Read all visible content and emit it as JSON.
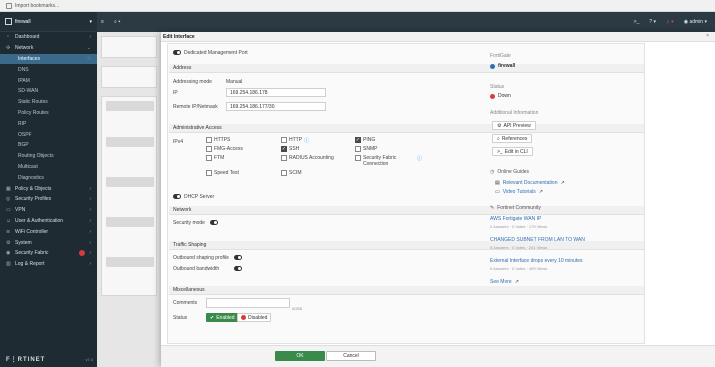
{
  "bookmarks": {
    "label": "Import bookmarks..."
  },
  "sidebar": {
    "device": "firewall",
    "items": [
      {
        "label": "Dashboard",
        "icon": "dashboard-icon",
        "top": true,
        "arrow": "›"
      },
      {
        "label": "Network",
        "icon": "network-icon",
        "top": true,
        "arrow": "⌄"
      },
      {
        "label": "Interfaces",
        "sub": true,
        "active": true,
        "arrow": "☆"
      },
      {
        "label": "DNS",
        "sub": true
      },
      {
        "label": "IPAM",
        "sub": true
      },
      {
        "label": "SD-WAN",
        "sub": true
      },
      {
        "label": "Static Routes",
        "sub": true
      },
      {
        "label": "Policy Routes",
        "sub": true
      },
      {
        "label": "RIP",
        "sub": true
      },
      {
        "label": "OSPF",
        "sub": true
      },
      {
        "label": "BGP",
        "sub": true
      },
      {
        "label": "Routing Objects",
        "sub": true
      },
      {
        "label": "Multicast",
        "sub": true
      },
      {
        "label": "Diagnostics",
        "sub": true
      },
      {
        "label": "Policy & Objects",
        "icon": "policy-icon",
        "top": true,
        "arrow": "›"
      },
      {
        "label": "Security Profiles",
        "icon": "security-profiles-icon",
        "top": true,
        "arrow": "›"
      },
      {
        "label": "VPN",
        "icon": "vpn-icon",
        "top": true,
        "arrow": "›"
      },
      {
        "label": "User & Authentication",
        "icon": "user-icon",
        "top": true,
        "arrow": "›"
      },
      {
        "label": "WiFi Controller",
        "icon": "wifi-icon",
        "top": true,
        "arrow": "›"
      },
      {
        "label": "System",
        "icon": "system-icon",
        "top": true,
        "arrow": "›"
      },
      {
        "label": "Security Fabric",
        "icon": "security-fabric-icon",
        "top": true,
        "arrow": "›",
        "badge": true
      },
      {
        "label": "Log & Report",
        "icon": "log-icon",
        "top": true,
        "arrow": "›"
      }
    ],
    "logo": "F⋮RTINET",
    "version": "v7.4"
  },
  "topbar": {
    "user": "admin"
  },
  "dialog": {
    "title": "Edit Interface",
    "dedicated_mgmt": "Dedicated Management Port",
    "sections": {
      "address": "Address",
      "admin_access": "Administrative Access",
      "dhcp": "DHCP Server",
      "network": "Network",
      "traffic": "Traffic Shaping",
      "misc": "Miscellaneous"
    },
    "addressing_mode_label": "Addressing mode",
    "addressing_mode_value": "Manual",
    "ip_label": "IP",
    "ip_value": "169.254.186.178",
    "remote_label": "Remote IP/Netmask",
    "remote_value": "169.254.186.177/30",
    "ipv4_label": "IPv4",
    "access": [
      {
        "label": "HTTPS",
        "checked": false
      },
      {
        "label": "HTTP",
        "checked": false,
        "info": true
      },
      {
        "label": "PING",
        "checked": true
      },
      {
        "label": "FMG-Access",
        "checked": false
      },
      {
        "label": "SSH",
        "checked": true
      },
      {
        "label": "SNMP",
        "checked": false
      },
      {
        "label": "FTM",
        "checked": false
      },
      {
        "label": "RADIUS Accounting",
        "checked": false
      },
      {
        "label": "Security Fabric Connection",
        "checked": false,
        "info": true
      },
      {
        "label": "Speed Test",
        "checked": false
      },
      {
        "label": "SCIM",
        "checked": false
      }
    ],
    "security_mode_label": "Security mode",
    "outbound_profile_label": "Outbound shaping profile",
    "outbound_bw_label": "Outbound bandwidth",
    "comments_label": "Comments",
    "comments_counter": "0/255",
    "status_label": "Status",
    "enabled_label": "Enabled",
    "disabled_label": "Disabled"
  },
  "right_panel": {
    "fortigate_h": "FortiGate",
    "fortigate_v": "firewall",
    "status_h": "Status",
    "status_v": "Down",
    "additional_h": "Additional Information",
    "api_preview": "API Preview",
    "references": "References",
    "edit_cli": "Edit in CLI",
    "online_guides": "Online Guides",
    "relevant_doc": "Relevant Documentation",
    "video_tutorials": "Video Tutorials",
    "community_h": "Fortinet Community",
    "posts": [
      {
        "title": "AWS Fortigate WAN IP",
        "meta": "2 Answers  ·  0 Votes  ·  179 Views"
      },
      {
        "title": "CHANGED SUBNET FROM LAN TO WAN",
        "meta": "5 Answers  ·  0 Votes  ·  201 Views"
      },
      {
        "title": "External Interface drops every 10 minutes",
        "meta": "9 Answers  ·  0 Votes  ·  499 Views"
      }
    ],
    "see_more": "See More"
  },
  "footer": {
    "ok": "OK",
    "cancel": "Cancel"
  },
  "colors": {
    "accent": "#3a8a4b",
    "sidebar": "#1f2b33",
    "link": "#2f6fb4",
    "down": "#d83b3b"
  }
}
